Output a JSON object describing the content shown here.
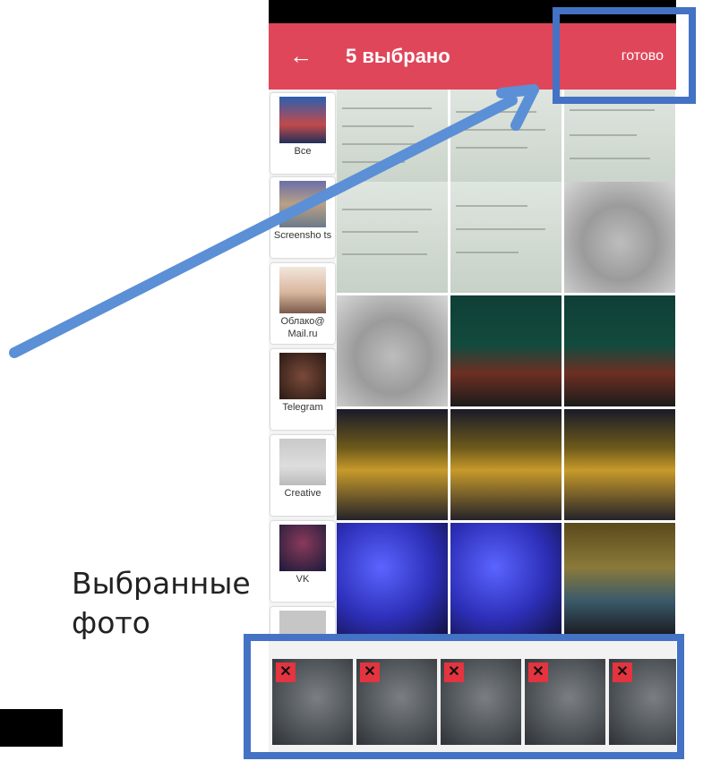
{
  "app": {
    "title": "5 выбрано",
    "done_label": "готово",
    "back_icon": "arrow-left-icon"
  },
  "albums": [
    {
      "label": "Все"
    },
    {
      "label": "Screensho ts"
    },
    {
      "label": "Облако@ Mail.ru"
    },
    {
      "label": "Telegram"
    },
    {
      "label": "Creative"
    },
    {
      "label": "VK"
    },
    {
      "label": ""
    }
  ],
  "annotation": {
    "caption": "Выбранные фото",
    "highlight_color": "#4472c4",
    "accent_color": "#e0465a"
  },
  "selected_strip": {
    "remove_icon": "close-icon",
    "remove_glyph": "✕"
  }
}
